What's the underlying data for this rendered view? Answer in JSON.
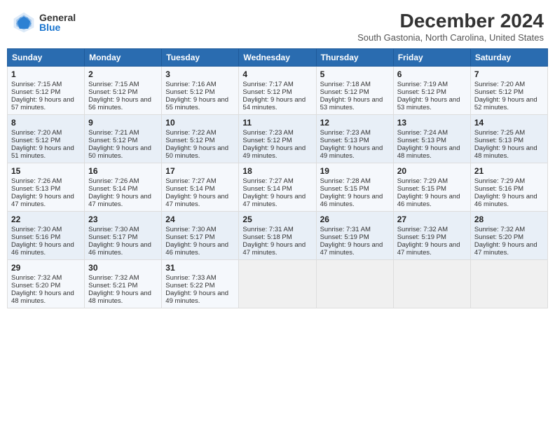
{
  "header": {
    "logo_general": "General",
    "logo_blue": "Blue",
    "month_title": "December 2024",
    "location": "South Gastonia, North Carolina, United States"
  },
  "calendar": {
    "days_of_week": [
      "Sunday",
      "Monday",
      "Tuesday",
      "Wednesday",
      "Thursday",
      "Friday",
      "Saturday"
    ],
    "weeks": [
      [
        {
          "day": "1",
          "sunrise": "Sunrise: 7:15 AM",
          "sunset": "Sunset: 5:12 PM",
          "daylight": "Daylight: 9 hours and 57 minutes."
        },
        {
          "day": "2",
          "sunrise": "Sunrise: 7:15 AM",
          "sunset": "Sunset: 5:12 PM",
          "daylight": "Daylight: 9 hours and 56 minutes."
        },
        {
          "day": "3",
          "sunrise": "Sunrise: 7:16 AM",
          "sunset": "Sunset: 5:12 PM",
          "daylight": "Daylight: 9 hours and 55 minutes."
        },
        {
          "day": "4",
          "sunrise": "Sunrise: 7:17 AM",
          "sunset": "Sunset: 5:12 PM",
          "daylight": "Daylight: 9 hours and 54 minutes."
        },
        {
          "day": "5",
          "sunrise": "Sunrise: 7:18 AM",
          "sunset": "Sunset: 5:12 PM",
          "daylight": "Daylight: 9 hours and 53 minutes."
        },
        {
          "day": "6",
          "sunrise": "Sunrise: 7:19 AM",
          "sunset": "Sunset: 5:12 PM",
          "daylight": "Daylight: 9 hours and 53 minutes."
        },
        {
          "day": "7",
          "sunrise": "Sunrise: 7:20 AM",
          "sunset": "Sunset: 5:12 PM",
          "daylight": "Daylight: 9 hours and 52 minutes."
        }
      ],
      [
        {
          "day": "8",
          "sunrise": "Sunrise: 7:20 AM",
          "sunset": "Sunset: 5:12 PM",
          "daylight": "Daylight: 9 hours and 51 minutes."
        },
        {
          "day": "9",
          "sunrise": "Sunrise: 7:21 AM",
          "sunset": "Sunset: 5:12 PM",
          "daylight": "Daylight: 9 hours and 50 minutes."
        },
        {
          "day": "10",
          "sunrise": "Sunrise: 7:22 AM",
          "sunset": "Sunset: 5:12 PM",
          "daylight": "Daylight: 9 hours and 50 minutes."
        },
        {
          "day": "11",
          "sunrise": "Sunrise: 7:23 AM",
          "sunset": "Sunset: 5:12 PM",
          "daylight": "Daylight: 9 hours and 49 minutes."
        },
        {
          "day": "12",
          "sunrise": "Sunrise: 7:23 AM",
          "sunset": "Sunset: 5:13 PM",
          "daylight": "Daylight: 9 hours and 49 minutes."
        },
        {
          "day": "13",
          "sunrise": "Sunrise: 7:24 AM",
          "sunset": "Sunset: 5:13 PM",
          "daylight": "Daylight: 9 hours and 48 minutes."
        },
        {
          "day": "14",
          "sunrise": "Sunrise: 7:25 AM",
          "sunset": "Sunset: 5:13 PM",
          "daylight": "Daylight: 9 hours and 48 minutes."
        }
      ],
      [
        {
          "day": "15",
          "sunrise": "Sunrise: 7:26 AM",
          "sunset": "Sunset: 5:13 PM",
          "daylight": "Daylight: 9 hours and 47 minutes."
        },
        {
          "day": "16",
          "sunrise": "Sunrise: 7:26 AM",
          "sunset": "Sunset: 5:14 PM",
          "daylight": "Daylight: 9 hours and 47 minutes."
        },
        {
          "day": "17",
          "sunrise": "Sunrise: 7:27 AM",
          "sunset": "Sunset: 5:14 PM",
          "daylight": "Daylight: 9 hours and 47 minutes."
        },
        {
          "day": "18",
          "sunrise": "Sunrise: 7:27 AM",
          "sunset": "Sunset: 5:14 PM",
          "daylight": "Daylight: 9 hours and 47 minutes."
        },
        {
          "day": "19",
          "sunrise": "Sunrise: 7:28 AM",
          "sunset": "Sunset: 5:15 PM",
          "daylight": "Daylight: 9 hours and 46 minutes."
        },
        {
          "day": "20",
          "sunrise": "Sunrise: 7:29 AM",
          "sunset": "Sunset: 5:15 PM",
          "daylight": "Daylight: 9 hours and 46 minutes."
        },
        {
          "day": "21",
          "sunrise": "Sunrise: 7:29 AM",
          "sunset": "Sunset: 5:16 PM",
          "daylight": "Daylight: 9 hours and 46 minutes."
        }
      ],
      [
        {
          "day": "22",
          "sunrise": "Sunrise: 7:30 AM",
          "sunset": "Sunset: 5:16 PM",
          "daylight": "Daylight: 9 hours and 46 minutes."
        },
        {
          "day": "23",
          "sunrise": "Sunrise: 7:30 AM",
          "sunset": "Sunset: 5:17 PM",
          "daylight": "Daylight: 9 hours and 46 minutes."
        },
        {
          "day": "24",
          "sunrise": "Sunrise: 7:30 AM",
          "sunset": "Sunset: 5:17 PM",
          "daylight": "Daylight: 9 hours and 46 minutes."
        },
        {
          "day": "25",
          "sunrise": "Sunrise: 7:31 AM",
          "sunset": "Sunset: 5:18 PM",
          "daylight": "Daylight: 9 hours and 47 minutes."
        },
        {
          "day": "26",
          "sunrise": "Sunrise: 7:31 AM",
          "sunset": "Sunset: 5:19 PM",
          "daylight": "Daylight: 9 hours and 47 minutes."
        },
        {
          "day": "27",
          "sunrise": "Sunrise: 7:32 AM",
          "sunset": "Sunset: 5:19 PM",
          "daylight": "Daylight: 9 hours and 47 minutes."
        },
        {
          "day": "28",
          "sunrise": "Sunrise: 7:32 AM",
          "sunset": "Sunset: 5:20 PM",
          "daylight": "Daylight: 9 hours and 47 minutes."
        }
      ],
      [
        {
          "day": "29",
          "sunrise": "Sunrise: 7:32 AM",
          "sunset": "Sunset: 5:20 PM",
          "daylight": "Daylight: 9 hours and 48 minutes."
        },
        {
          "day": "30",
          "sunrise": "Sunrise: 7:32 AM",
          "sunset": "Sunset: 5:21 PM",
          "daylight": "Daylight: 9 hours and 48 minutes."
        },
        {
          "day": "31",
          "sunrise": "Sunrise: 7:33 AM",
          "sunset": "Sunset: 5:22 PM",
          "daylight": "Daylight: 9 hours and 49 minutes."
        },
        {
          "day": "",
          "sunrise": "",
          "sunset": "",
          "daylight": ""
        },
        {
          "day": "",
          "sunrise": "",
          "sunset": "",
          "daylight": ""
        },
        {
          "day": "",
          "sunrise": "",
          "sunset": "",
          "daylight": ""
        },
        {
          "day": "",
          "sunrise": "",
          "sunset": "",
          "daylight": ""
        }
      ]
    ]
  }
}
